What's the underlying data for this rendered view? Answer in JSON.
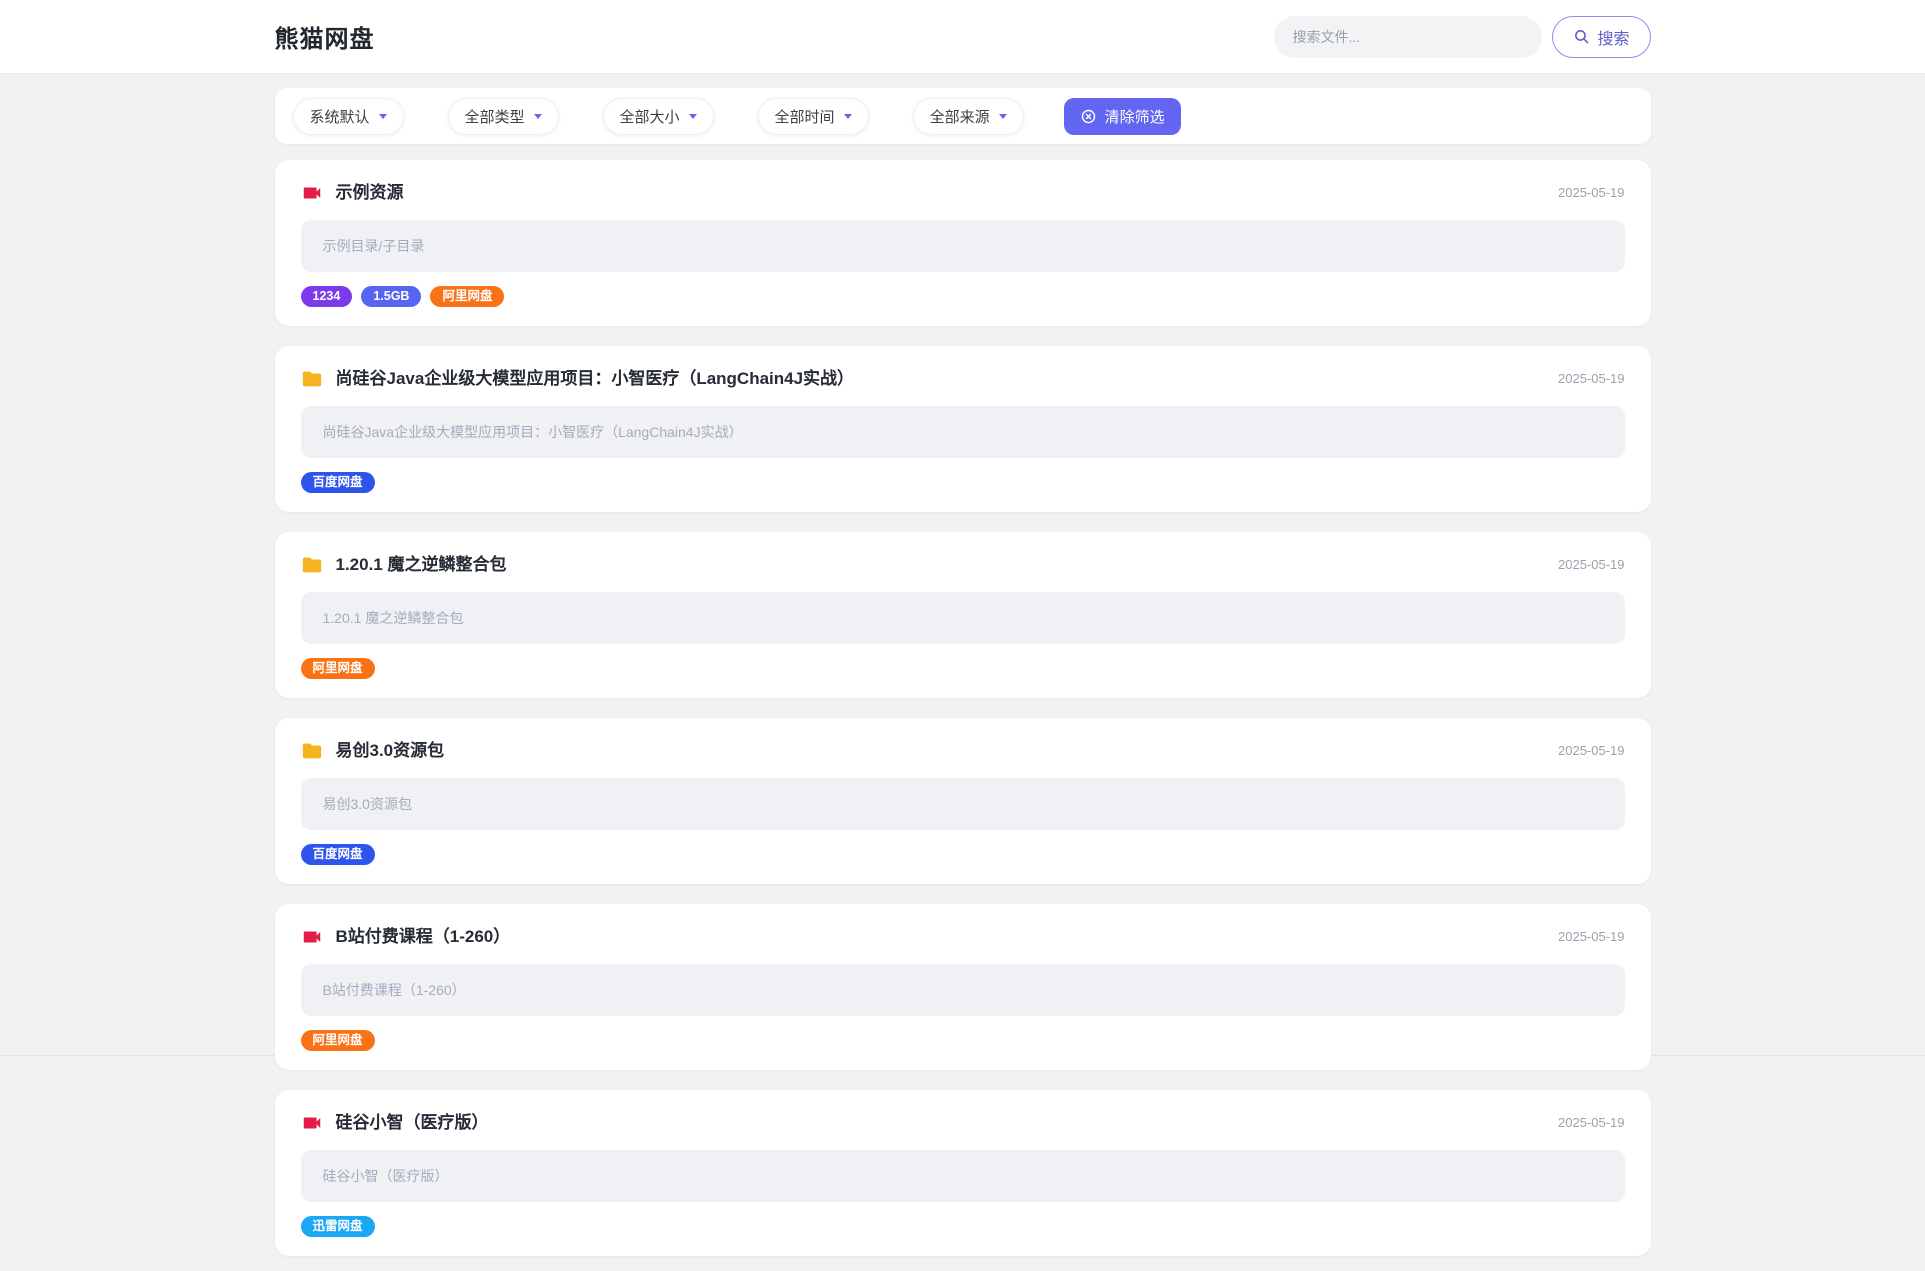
{
  "header": {
    "title": "熊猫网盘",
    "search": {
      "placeholder": "搜索文件...",
      "value": "",
      "button_label": "搜索"
    }
  },
  "filters": {
    "items": [
      {
        "label": "系统默认"
      },
      {
        "label": "全部类型"
      },
      {
        "label": "全部大小"
      },
      {
        "label": "全部时间"
      },
      {
        "label": "全部来源"
      }
    ],
    "clear_label": "清除筛选"
  },
  "colors": {
    "accent": "#6366f1",
    "video_icon": "#e11d48",
    "folder_icon": "#f5b41f",
    "badge_purple": "#7c3aed",
    "badge_indigo": "#5865f2",
    "badge_orange": "#f97316",
    "badge_blue": "#2f54eb",
    "badge_sky": "#1aa7f4"
  },
  "results": [
    {
      "icon": "video",
      "title": "示例资源",
      "date": "2025-05-19",
      "desc": "示例目录/子目录",
      "badges": [
        {
          "text": "1234",
          "color": "#7c3aed"
        },
        {
          "text": "1.5GB",
          "color": "#5865f2"
        },
        {
          "text": "阿里网盘",
          "color": "#f97316"
        }
      ]
    },
    {
      "icon": "folder",
      "title": "尚硅谷Java企业级大模型应用项目：小智医疗（LangChain4J实战）",
      "date": "2025-05-19",
      "desc": "尚硅谷Java企业级大模型应用项目：小智医疗（LangChain4J实战）",
      "badges": [
        {
          "text": "百度网盘",
          "color": "#2f54eb"
        }
      ]
    },
    {
      "icon": "folder",
      "title": "1.20.1 魔之逆鳞整合包",
      "date": "2025-05-19",
      "desc": "1.20.1 魔之逆鳞整合包",
      "badges": [
        {
          "text": "阿里网盘",
          "color": "#f97316"
        }
      ]
    },
    {
      "icon": "folder",
      "title": "易创3.0资源包",
      "date": "2025-05-19",
      "desc": "易创3.0资源包",
      "badges": [
        {
          "text": "百度网盘",
          "color": "#2f54eb"
        }
      ]
    },
    {
      "icon": "video",
      "title": "B站付费课程（1-260）",
      "date": "2025-05-19",
      "desc": "B站付费课程（1-260）",
      "badges": [
        {
          "text": "阿里网盘",
          "color": "#f97316"
        }
      ]
    },
    {
      "icon": "video",
      "title": "硅谷小智（医疗版）",
      "date": "2025-05-19",
      "desc": "硅谷小智（医疗版）",
      "badges": [
        {
          "text": "迅雷网盘",
          "color": "#1aa7f4"
        }
      ]
    }
  ]
}
